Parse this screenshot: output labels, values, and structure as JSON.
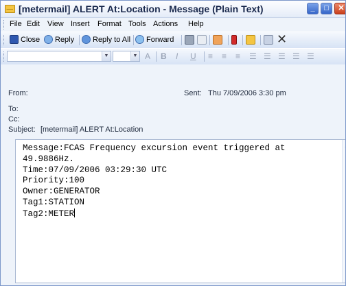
{
  "window": {
    "title": "[metermail] ALERT At:Location - Message (Plain Text)",
    "buttons": {
      "minimize": "_",
      "maximize": "□",
      "close": "✕"
    }
  },
  "menu": [
    "File",
    "Edit",
    "View",
    "Insert",
    "Format",
    "Tools",
    "Actions",
    "Help"
  ],
  "toolbar": {
    "close": "Close",
    "reply": "Reply",
    "reply_all": "Reply to All",
    "forward": "Forward"
  },
  "format_toolbar": {
    "font_size_symbol": "A",
    "bold": "B",
    "italic": "I",
    "underline": "U"
  },
  "header": {
    "from_label": "From:",
    "from_value": "",
    "sent_label": "Sent:",
    "sent_value": "Thu 7/09/2006 3:30 pm",
    "to_label": "To:",
    "to_value": "",
    "cc_label": "Cc:",
    "cc_value": "",
    "subject_label": "Subject:",
    "subject_value": "[metermail] ALERT At:Location"
  },
  "body": {
    "lines": [
      "Message:FCAS Frequency excursion event triggered at",
      "49.9886Hz.",
      "Time:07/09/2006 03:29:30 UTC",
      "Priority:100",
      "Owner:GENERATOR",
      "Tag1:STATION",
      "Tag2:METER"
    ]
  },
  "icons": [
    "envelope-icon",
    "save-icon",
    "reply-icon",
    "reply-all-icon",
    "forward-icon",
    "print-icon",
    "copy-icon",
    "flag-icon",
    "move-icon",
    "delete-icon",
    "scroll-up-icon"
  ],
  "colors": {
    "title_text": "#1b2a4e",
    "close_button": "#c9401c",
    "window_border": "#7a96c9"
  }
}
